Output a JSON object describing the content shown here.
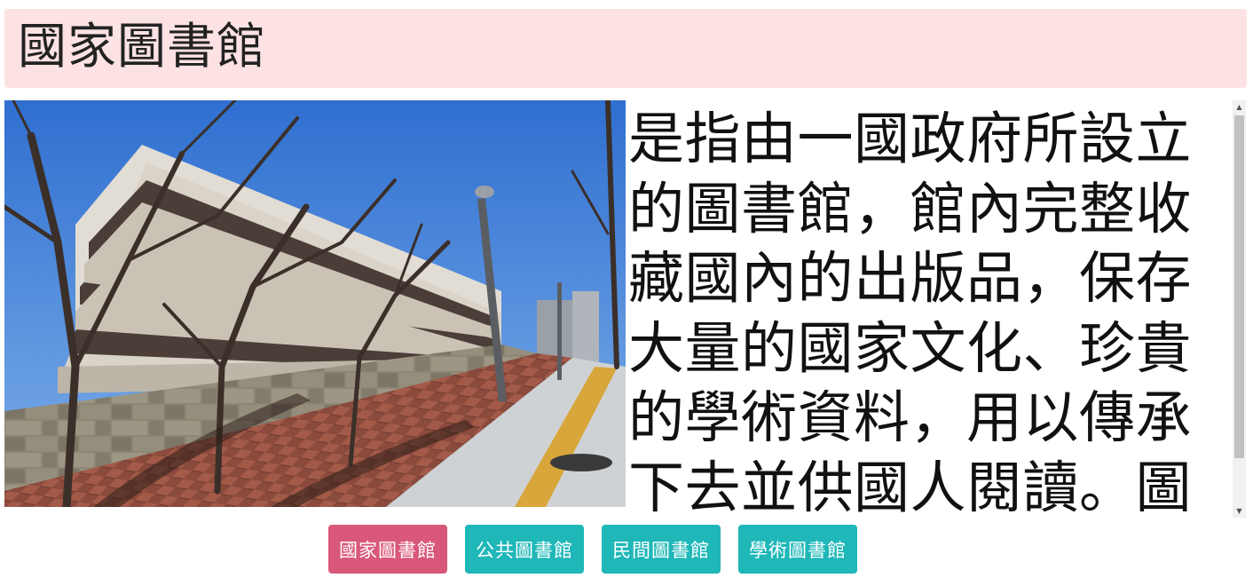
{
  "header": {
    "title": "國家圖書館"
  },
  "main": {
    "description": "是指由一國政府所設立的圖書館，館內完整收藏國內的出版品，保存大量的國家文化、珍貴的學術資料，用以傳承下去並供國人閱讀。圖為日本國家圖"
  },
  "nav": {
    "buttons": [
      {
        "label": "國家圖書館",
        "color": "#d9587a",
        "active": true
      },
      {
        "label": "公共圖書館",
        "color": "#1fb7b8",
        "active": false
      },
      {
        "label": "民間圖書館",
        "color": "#1fb7b8",
        "active": false
      },
      {
        "label": "學術圖書館",
        "color": "#1fb7b8",
        "active": false
      }
    ]
  },
  "scrollbar": {
    "up_icon": "triangle-up",
    "down_icon": "triangle-down"
  }
}
